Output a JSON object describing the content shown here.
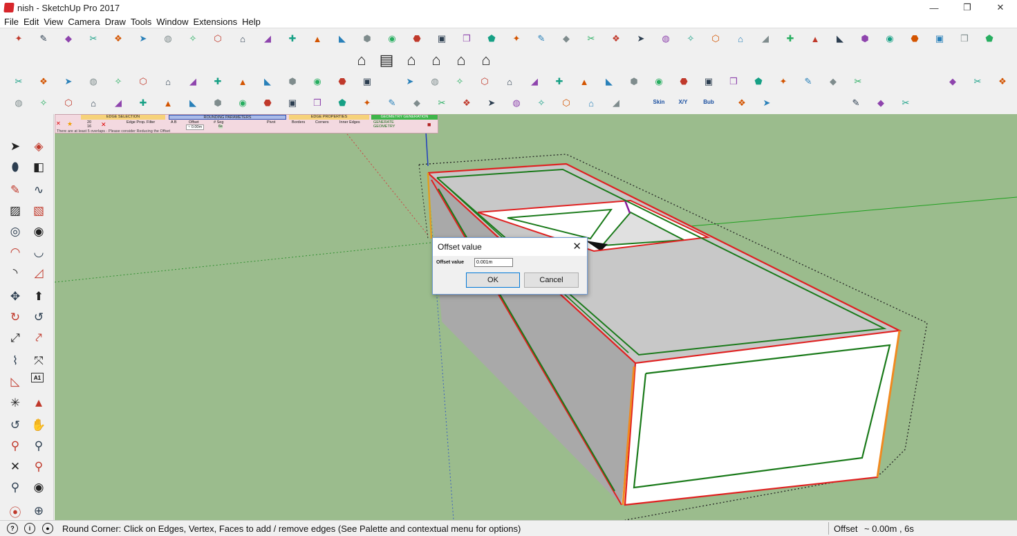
{
  "window": {
    "title": "nish - SketchUp Pro 2017",
    "minimize_glyph": "—",
    "restore_glyph": "❐",
    "close_glyph": "✕"
  },
  "menu": [
    "File",
    "Edit",
    "View",
    "Camera",
    "Draw",
    "Tools",
    "Window",
    "Extensions",
    "Help"
  ],
  "round_corner_palette": {
    "sections": {
      "edge_selection": "EDGE SELECTION",
      "rounding_parameters": "ROUNDING PARAMETERS",
      "edge_properties": "EDGE PROPERTIES",
      "geometry_generation": "GEOMETRY GENERATION"
    },
    "edge_prop_filter": "Edge Prop. Filter",
    "offset_label": "Offset",
    "offset_value": "~ 0.00m",
    "seg_label": "# Seg",
    "seg_value": "6s",
    "pivot_label": "Pivot",
    "borders_label": "Borders",
    "corners_label": "Corners",
    "inner_edges_label": "Inner Edges",
    "generate_label_1": "GENERATE",
    "generate_label_2": "GEOMETRY",
    "count_top": "20",
    "count_bottom": "16",
    "ab_label": "A B",
    "note": "There are at least 5 overlaps - Please consider Reducing the Offset"
  },
  "dialog": {
    "title": "Offset value",
    "close_glyph": "✕",
    "field_label": "Offset value",
    "field_value": "0.001m",
    "ok_label": "OK",
    "cancel_label": "Cancel"
  },
  "statusbar": {
    "message": "Round Corner: Click on Edges, Vertex, Faces to add / remove edges (See Palette and contextual menu for options)",
    "vcb_label": "Offset",
    "vcb_value": "~ 0.00m , 6s",
    "icon1": "?",
    "icon2": "i",
    "icon3": "●"
  },
  "toolbar_labels": {
    "skin": "Skin",
    "xy": "X/Y",
    "bub": "Bub",
    "a1": "A1"
  }
}
